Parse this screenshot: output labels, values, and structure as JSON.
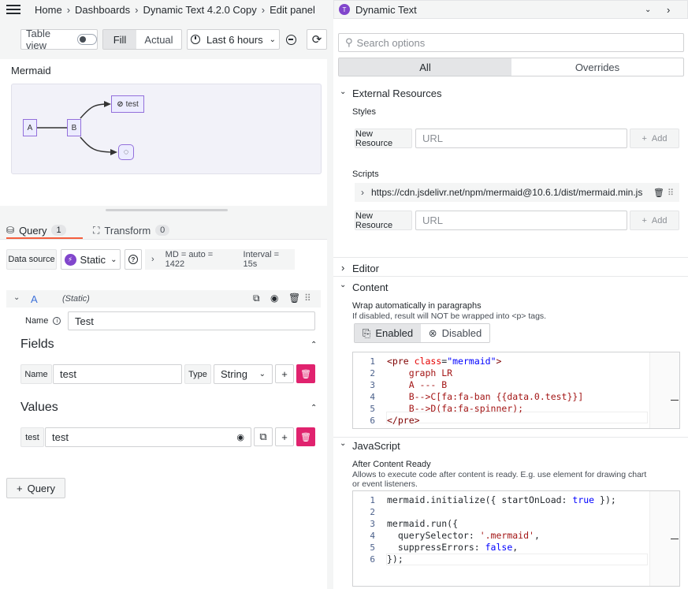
{
  "breadcrumb": [
    "Home",
    "Dashboards",
    "Dynamic Text 4.2.0 Copy",
    "Edit panel"
  ],
  "toolbar": {
    "table_view_label": "Table view",
    "fill_label": "Fill",
    "actual_label": "Actual",
    "time_range_label": "Last 6 hours"
  },
  "panel": {
    "title": "Mermaid",
    "nodes": {
      "a": "A",
      "b": "B",
      "c": "test"
    }
  },
  "query_tabs": {
    "query_label": "Query",
    "query_count": "1",
    "transform_label": "Transform",
    "transform_count": "0"
  },
  "datasource": {
    "label": "Data source",
    "value": "Static",
    "md_info": "MD = auto = 1422",
    "interval_info": "Interval = 15s"
  },
  "query_row": {
    "ref": "A",
    "source": "(Static)",
    "name_label": "Name",
    "name_value": "Test",
    "fields_title": "Fields",
    "field_name_label": "Name",
    "field_name_value": "test",
    "field_type_label": "Type",
    "field_type_value": "String",
    "values_title": "Values",
    "value_label": "test",
    "value_value": "test"
  },
  "add_query_label": "Query",
  "options": {
    "plugin_title": "Dynamic Text",
    "search_placeholder": "Search options",
    "tab_all": "All",
    "tab_overrides": "Overrides"
  },
  "external_resources": {
    "title": "External Resources",
    "styles_label": "Styles",
    "new_resource_label": "New Resource",
    "url_placeholder": "URL",
    "add_label": "Add",
    "scripts_label": "Scripts",
    "script_url": "https://cdn.jsdelivr.net/npm/mermaid@10.6.1/dist/mermaid.min.js"
  },
  "editor_section": {
    "title": "Editor"
  },
  "content_section": {
    "title": "Content",
    "wrap_label": "Wrap automatically in paragraphs",
    "wrap_desc": "If disabled, result will NOT be wrapped into <p> tags.",
    "enabled_label": "Enabled",
    "disabled_label": "Disabled",
    "code_lines": [
      {
        "n": "1",
        "t": "<pre class=\"mermaid\">"
      },
      {
        "n": "2",
        "t": "    graph LR"
      },
      {
        "n": "3",
        "t": "    A --- B"
      },
      {
        "n": "4",
        "t": "    B-->C[fa:fa-ban {{data.0.test}}]"
      },
      {
        "n": "5",
        "t": "    B-->D(fa:fa-spinner);"
      },
      {
        "n": "6",
        "t": "</pre>"
      }
    ]
  },
  "javascript_section": {
    "title": "JavaScript",
    "after_label": "After Content Ready",
    "after_desc_1": "Allows to execute code after content is ready. E.g. use element for drawing chart",
    "after_desc_2": "or event listeners.",
    "code_lines": [
      {
        "n": "1",
        "t": "mermaid.initialize({ startOnLoad: true });"
      },
      {
        "n": "2",
        "t": ""
      },
      {
        "n": "3",
        "t": "mermaid.run({"
      },
      {
        "n": "4",
        "t": "  querySelector: '.mermaid',"
      },
      {
        "n": "5",
        "t": "  suppressErrors: false,"
      },
      {
        "n": "6",
        "t": "});"
      }
    ]
  },
  "colors": {
    "accent": "#f55f3e",
    "danger": "#e0226e",
    "blue": "#3d71d9"
  }
}
